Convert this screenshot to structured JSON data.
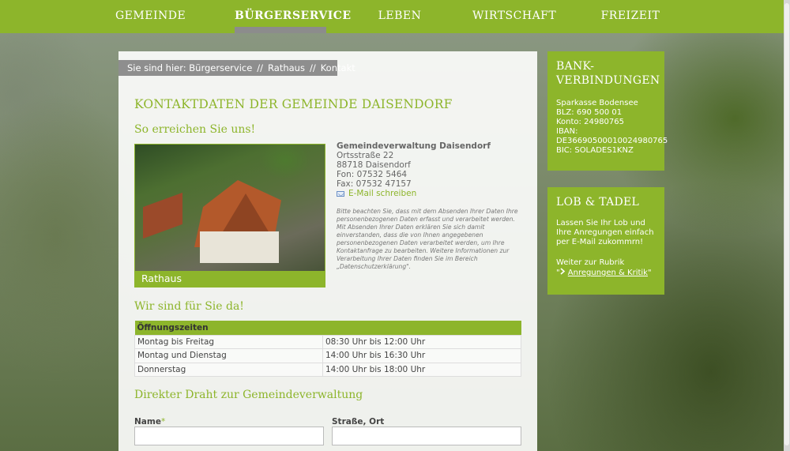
{
  "nav": {
    "items": [
      {
        "label": "GEMEINDE"
      },
      {
        "label": "BÜRGERSERVICE"
      },
      {
        "label": "LEBEN"
      },
      {
        "label": "WIRTSCHAFT"
      },
      {
        "label": "FREIZEIT"
      }
    ],
    "active": "BÜRGERSERVICE"
  },
  "breadcrumb": {
    "prefix": "Sie sind hier:",
    "items": [
      "Bürgerservice",
      "Rathaus",
      "Kontakt"
    ],
    "separator": "//"
  },
  "main": {
    "title": "KONTAKTDATEN DER GEMEINDE DAISENDORF",
    "reach_heading": "So erreichen Sie uns!",
    "photo_caption": "Rathaus",
    "address": {
      "org": "Gemeindeverwaltung Daisendorf",
      "street": "Ortsstraße 22",
      "city": "88718 Daisendorf",
      "phone": "Fon: 07532 5464",
      "fax": "Fax: 07532 47157",
      "email_link": "E-Mail schreiben",
      "email_icon": "envelope-icon"
    },
    "privacy_note": "Bitte beachten Sie, dass mit dem Absenden Ihrer Daten Ihre personenbezogenen Daten erfasst und verarbeitet werden. Mit Absenden Ihrer Daten erklären Sie sich damit einverstanden, dass die von Ihnen angegebenen personenbezogenen Daten verarbeitet werden, um Ihre Kontaktanfrage zu bearbeiten. Weitere Informationen zur Verarbeitung Ihrer Daten finden Sie im Bereich „Datenschutzerklärung\".",
    "hours_heading": "Wir sind für Sie da!",
    "hours_table": {
      "header": "Öffnungszeiten",
      "rows": [
        {
          "day": "Montag bis Freitag",
          "time": "08:30 Uhr bis 12:00 Uhr"
        },
        {
          "day": "Montag und Dienstag",
          "time": "14:00 Uhr bis 16:30 Uhr"
        },
        {
          "day": "Donnerstag",
          "time": "14:00 Uhr bis 18:00 Uhr"
        }
      ]
    },
    "form_heading": "Direkter Draht zur Gemeindeverwaltung",
    "form": {
      "name_label": "Name",
      "name_required": "*",
      "name_value": "",
      "street_label": "Straße, Ort",
      "street_value": ""
    }
  },
  "sidebar": {
    "bank": {
      "title_line1": "BANK-",
      "title_line2": "VERBINDUNGEN",
      "bank_name": "Sparkasse Bodensee",
      "blz": "BLZ: 690 500 01",
      "konto": "Konto: 24980765",
      "iban_label": "IBAN:",
      "iban": "DE36690500010024980765",
      "bic": "BIC: SOLADES1KNZ"
    },
    "feedback": {
      "title": "LOB & TADEL",
      "text": "Lassen Sie Ihr Lob und Ihre Anregungen einfach per E-Mail zukommrn!",
      "rubric_text": "Weiter zur Rubrik",
      "link_quote_open": "\"",
      "link_arrow": "arrow-right-icon",
      "link_label": "Anregungen & Kritik",
      "link_quote_close": "\""
    }
  },
  "colors": {
    "accent": "#8db52b",
    "breadcrumb_bg": "#8e8e8e",
    "active_bar": "#8c8c8c"
  }
}
